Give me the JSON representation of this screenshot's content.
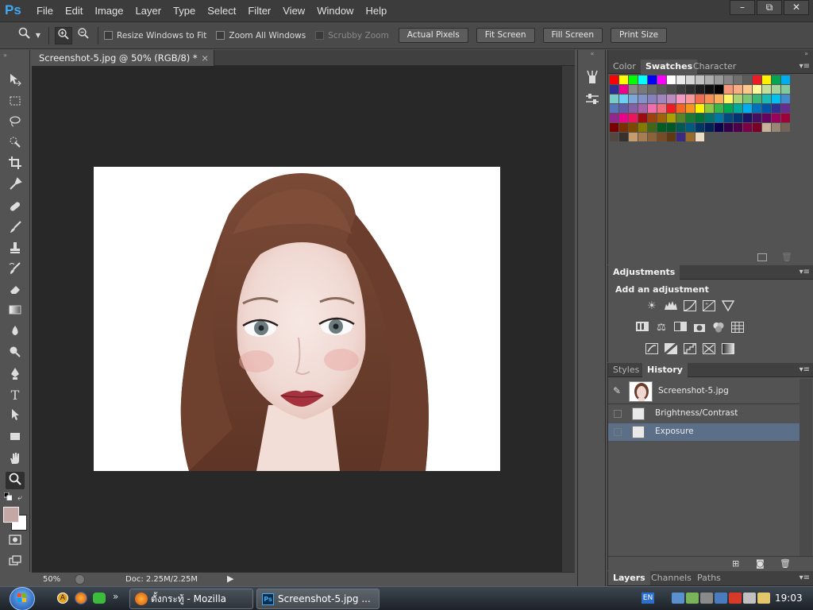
{
  "app": {
    "logo": "Ps"
  },
  "menu": [
    "File",
    "Edit",
    "Image",
    "Layer",
    "Type",
    "Select",
    "Filter",
    "View",
    "Window",
    "Help"
  ],
  "window_controls": [
    "–",
    "⧉",
    "✕"
  ],
  "options_bar": {
    "checkboxes": [
      {
        "label": "Resize Windows to Fit",
        "enabled": true
      },
      {
        "label": "Zoom All Windows",
        "enabled": true
      },
      {
        "label": "Scrubby Zoom",
        "enabled": false
      }
    ],
    "buttons": [
      "Actual Pixels",
      "Fit Screen",
      "Fill Screen",
      "Print Size"
    ]
  },
  "document": {
    "tab_title": "Screenshot-5.jpg @ 50% (RGB/8) *",
    "zoom": "50%",
    "doc_info": "Doc: 2.25M/2.25M"
  },
  "panels": {
    "swatches_tabs": [
      "Color",
      "Swatches",
      "Character"
    ],
    "adjustments": {
      "tab": "Adjustments",
      "heading": "Add an adjustment"
    },
    "history_tabs": [
      "Styles",
      "History"
    ],
    "history": {
      "snapshot": "Screenshot-5.jpg",
      "steps": [
        "Brightness/Contrast",
        "Exposure"
      ]
    },
    "layers_tabs": [
      "Layers",
      "Channels",
      "Paths"
    ]
  },
  "taskbar": {
    "items": [
      "ตั้งกระทู้ - Mozilla Fire...",
      "Screenshot-5.jpg ..."
    ],
    "lang": "EN",
    "clock": "19:03"
  },
  "colors": {
    "accent": "#3fa9f5",
    "selected_history": "#5c6f89",
    "foreground_swatch": "#c5a8a6"
  },
  "swatch_colors": [
    "#ff0000",
    "#ffff00",
    "#00ff00",
    "#00ffff",
    "#0000ff",
    "#ff00ff",
    "#ffffff",
    "#ebebeb",
    "#d6d6d6",
    "#c2c2c2",
    "#adadad",
    "#999999",
    "#858585",
    "#707070",
    "#5c5c5c",
    "#ed1c24",
    "#fff200",
    "#00a651",
    "#00aeef",
    "#2e3192",
    "#ec008c",
    "#8a8a8a",
    "#7a7a7a",
    "#6b6b6b",
    "#5b5b5b",
    "#4c4c4c",
    "#3c3c3c",
    "#2d2d2d",
    "#1d1d1d",
    "#0e0e0e",
    "#000000",
    "#f7977a",
    "#f9ad81",
    "#fdc68a",
    "#fff79a",
    "#c4df9b",
    "#a3d39c",
    "#82ca9c",
    "#7accc8",
    "#6dcff6",
    "#7da7d9",
    "#8393ca",
    "#8781bd",
    "#a186be",
    "#bd8cbf",
    "#f49ac2",
    "#f6989d",
    "#f26c4f",
    "#f68e56",
    "#fbaf5d",
    "#fff467",
    "#acd372",
    "#7cc576",
    "#3bb878",
    "#1abbb4",
    "#00bff3",
    "#448ccb",
    "#5574b9",
    "#605ca8",
    "#855fa8",
    "#a763a8",
    "#f06eaa",
    "#f26d7d",
    "#ed1c24",
    "#f26522",
    "#f7941d",
    "#fff200",
    "#8dc63f",
    "#39b54a",
    "#00a651",
    "#00a99d",
    "#00aeef",
    "#0072bc",
    "#0054a6",
    "#2e3192",
    "#662d91",
    "#92278f",
    "#ec008c",
    "#ed145b",
    "#9e0b0f",
    "#a0410d",
    "#a36209",
    "#aba000",
    "#598527",
    "#197b30",
    "#007236",
    "#00746b",
    "#0076a3",
    "#004a80",
    "#003471",
    "#1b1464",
    "#440e62",
    "#630460",
    "#9e005d",
    "#9e0039",
    "#790000",
    "#7b2e00",
    "#7d4900",
    "#827b00",
    "#406618",
    "#005e20",
    "#005826",
    "#005952",
    "#005b7f",
    "#003663",
    "#002157",
    "#0d004c",
    "#32004b",
    "#4b0049",
    "#7b0046",
    "#7a0026",
    "#c7b299",
    "#998675",
    "#736357",
    "#534741",
    "#37302d",
    "#c69c6d",
    "#a67c52",
    "#8c6239",
    "#754c24",
    "#603913",
    "#3c2a80",
    "#9a6a2a",
    "#ecdcc4"
  ]
}
